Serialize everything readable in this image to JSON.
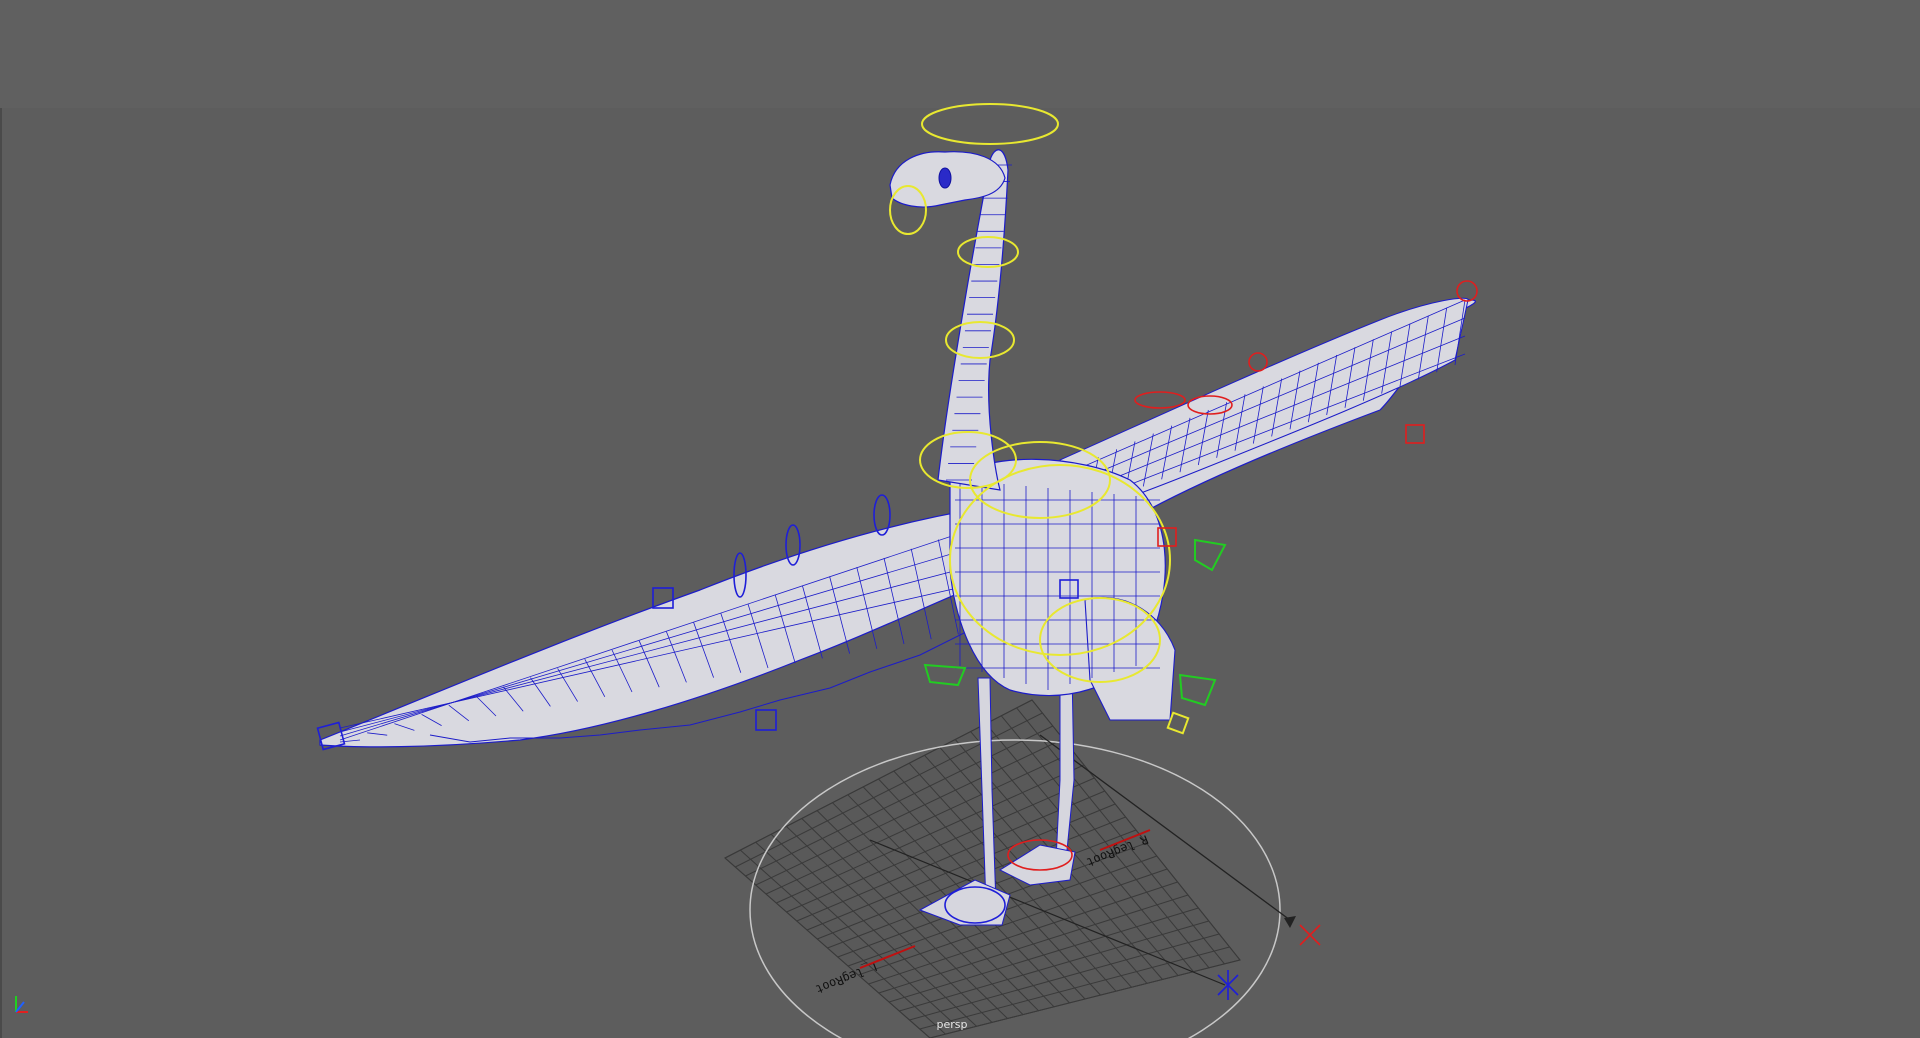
{
  "viewport": {
    "camera_name": "persp",
    "background_color": "#5d5d5d"
  },
  "scene": {
    "ground_labels": [
      "L_legRoot",
      "R_legRoot"
    ],
    "mesh_color": "#d9d9e0",
    "wire_color": "#1c1cc8",
    "control_colors": {
      "center": "#e8e830",
      "left": "#1e1ed8",
      "right": "#e01e1e",
      "ik": "#22cc22",
      "grid": "#3c3c3c"
    }
  },
  "axis_gizmo": {
    "x_color": "#e02020",
    "y_color": "#20d020",
    "z_color": "#2060ff"
  }
}
